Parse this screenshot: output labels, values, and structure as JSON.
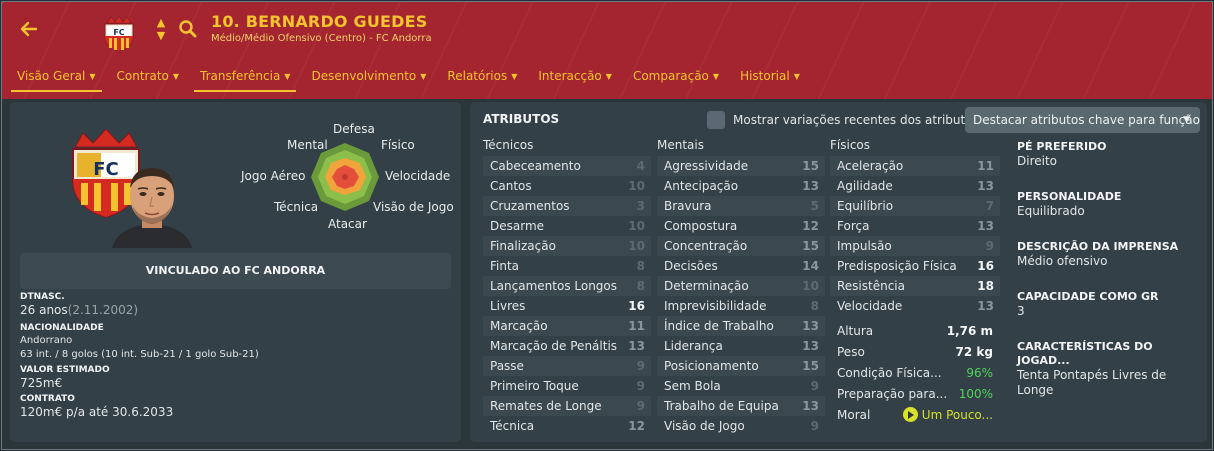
{
  "header": {
    "player_title": "10. BERNARDO GUEDES",
    "player_subtitle": "Médio/Médio Ofensivo (Centro) - FC Andorra",
    "club_crest_text": "FC"
  },
  "nav": [
    {
      "label": "Visão Geral",
      "active": true
    },
    {
      "label": "Contrato",
      "active": false
    },
    {
      "label": "Transferência",
      "active": true
    },
    {
      "label": "Desenvolvimento",
      "active": false
    },
    {
      "label": "Relatórios",
      "active": false
    },
    {
      "label": "Interacção",
      "active": false
    },
    {
      "label": "Comparação",
      "active": false
    },
    {
      "label": "Historial",
      "active": false
    }
  ],
  "profile": {
    "radar_labels": {
      "top": "Defesa",
      "top_left": "Mental",
      "top_right": "Físico",
      "left": "Jogo Aéreo",
      "right": "Velocidade",
      "bottom_left": "Técnica",
      "bottom_right": "Visão de Jogo",
      "bottom": "Atacar"
    },
    "contract_status": "VINCULADO AO FC ANDORRA",
    "dob_label": "DTNASC.",
    "age": "26 anos",
    "dob": "(2.11.2002)",
    "nationality_label": "NACIONALIDADE",
    "nationality": "Andorrano",
    "caps": "63 int. / 8 golos (10 int. Sub-21 / 1 golo Sub-21)",
    "value_label": "VALOR ESTIMADO",
    "value": "725m€",
    "contract_label": "CONTRATO",
    "contract": "120m€ p/a até 30.6.2033"
  },
  "attributes": {
    "title": "ATRIBUTOS",
    "toggle_label": "Mostrar variações recentes dos atributos",
    "dropdown_label": "Destacar atributos chave para função",
    "technical_header": "Técnicos",
    "mental_header": "Mentais",
    "physical_header": "Físicos",
    "technical": [
      {
        "name": "Cabeceamento",
        "value": "4"
      },
      {
        "name": "Cantos",
        "value": "10"
      },
      {
        "name": "Cruzamentos",
        "value": "3"
      },
      {
        "name": "Desarme",
        "value": "10"
      },
      {
        "name": "Finalização",
        "value": "10"
      },
      {
        "name": "Finta",
        "value": "8"
      },
      {
        "name": "Lançamentos Longos",
        "value": "8"
      },
      {
        "name": "Livres",
        "value": "16"
      },
      {
        "name": "Marcação",
        "value": "11"
      },
      {
        "name": "Marcação de Penáltis",
        "value": "13"
      },
      {
        "name": "Passe",
        "value": "9"
      },
      {
        "name": "Primeiro Toque",
        "value": "9"
      },
      {
        "name": "Remates de Longe",
        "value": "9"
      },
      {
        "name": "Técnica",
        "value": "12"
      }
    ],
    "mental": [
      {
        "name": "Agressividade",
        "value": "15"
      },
      {
        "name": "Antecipação",
        "value": "13"
      },
      {
        "name": "Bravura",
        "value": "5"
      },
      {
        "name": "Compostura",
        "value": "12"
      },
      {
        "name": "Concentração",
        "value": "15"
      },
      {
        "name": "Decisões",
        "value": "14"
      },
      {
        "name": "Determinação",
        "value": "10"
      },
      {
        "name": "Imprevisibilidade",
        "value": "8"
      },
      {
        "name": "Índice de Trabalho",
        "value": "13"
      },
      {
        "name": "Liderança",
        "value": "13"
      },
      {
        "name": "Posicionamento",
        "value": "15"
      },
      {
        "name": "Sem Bola",
        "value": "9"
      },
      {
        "name": "Trabalho de Equipa",
        "value": "13"
      },
      {
        "name": "Visão de Jogo",
        "value": "9"
      }
    ],
    "physical": [
      {
        "name": "Aceleração",
        "value": "11"
      },
      {
        "name": "Agilidade",
        "value": "13"
      },
      {
        "name": "Equilíbrio",
        "value": "7"
      },
      {
        "name": "Força",
        "value": "13"
      },
      {
        "name": "Impulsão",
        "value": "9"
      },
      {
        "name": "Predisposição Física",
        "value": "16"
      },
      {
        "name": "Resistência",
        "value": "18"
      },
      {
        "name": "Velocidade",
        "value": "13"
      }
    ],
    "height_label": "Altura",
    "height": "1,76 m",
    "weight_label": "Peso",
    "weight": "72 kg",
    "condition_label": "Condição Física...",
    "condition": "96%",
    "sharpness_label": "Preparação para...",
    "sharpness": "100%",
    "morale_label": "Moral",
    "morale": "Um Pouco...",
    "status_color_positive": "#52d25a",
    "morale_color": "#d8e02a"
  },
  "details": {
    "preferred_foot_label": "PÉ PREFERIDO",
    "preferred_foot": "Direito",
    "personality_label": "PERSONALIDADE",
    "personality": "Equilibrado",
    "media_label": "DESCRIÇÃO DA IMPRENSA",
    "media": "Médio ofensivo",
    "gk_label": "CAPACIDADE COMO GR",
    "gk": "3",
    "traits_label": "CARACTERÍSTICAS DO JOGAD...",
    "traits": "Tenta Pontapés Livres de Longe"
  },
  "colors": {
    "header_bg": "#a4242f",
    "accent": "#f4c430",
    "panel_bg": "#334047"
  }
}
